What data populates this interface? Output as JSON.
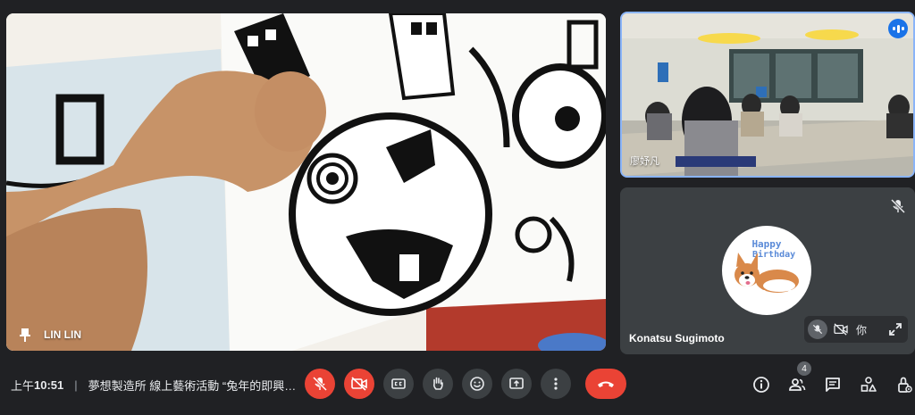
{
  "main_tile": {
    "participant_name": "LIN LIN"
  },
  "room_tile": {
    "participant_name": "廖妤凡"
  },
  "user_tile": {
    "participant_name": "Konatsu Sugimoto",
    "avatar_text_line1": "Happy",
    "avatar_text_line2": "Birthday",
    "self_label": "你"
  },
  "meeting": {
    "time_prefix": "上午",
    "time": "10:51",
    "separator": "|",
    "title": "夢想製造所 線上藝術活動 “兔年的即興…"
  },
  "participants_count": "4",
  "icons": {
    "pin": "pin-icon",
    "mic_off": "mic-off-icon",
    "camera_off": "camera-off-icon",
    "captions": "captions-icon",
    "raise_hand": "raise-hand-icon",
    "emoji": "emoji-icon",
    "present": "present-screen-icon",
    "more": "more-vert-icon",
    "end_call": "end-call-icon",
    "info": "info-icon",
    "people": "people-icon",
    "chat": "chat-icon",
    "activities": "activities-icon",
    "host_controls": "host-controls-icon"
  },
  "colors": {
    "accent": "#8ab4f8",
    "danger": "#ea4335",
    "background": "#202124",
    "tile": "#3c4043"
  }
}
